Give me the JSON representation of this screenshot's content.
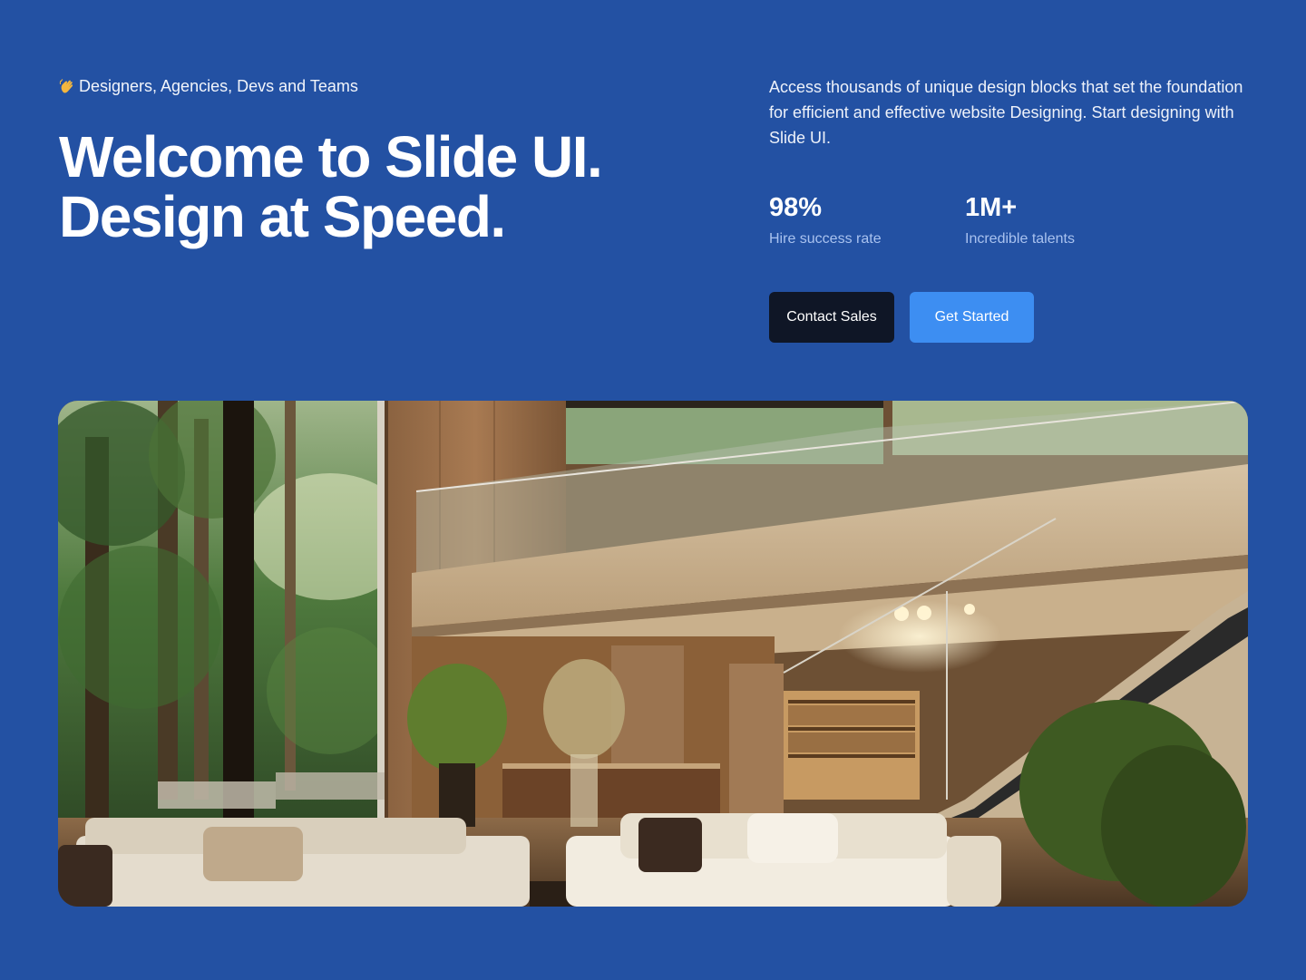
{
  "hero": {
    "eyebrow_text": "Designers, Agencies, Devs and Teams",
    "eyebrow_icon": "waving-hand-icon",
    "headline_line1": "Welcome to Slide UI.",
    "headline_line2": "Design at Speed.",
    "description": "Access thousands of unique design blocks that set the foundation for efficient and effective website Designing. Start designing with Slide UI.",
    "stats": [
      {
        "value": "98%",
        "label": "Hire success rate"
      },
      {
        "value": "1M+",
        "label": "Incredible talents"
      }
    ],
    "buttons": {
      "contact_label": "Contact Sales",
      "get_started_label": "Get Started"
    },
    "image_subject": "modern-living-room-interior"
  },
  "colors": {
    "background": "#2351a3",
    "primary_button": "#3d8ef2",
    "dark_button": "#0f1626",
    "stat_label": "#a9c2ef"
  }
}
